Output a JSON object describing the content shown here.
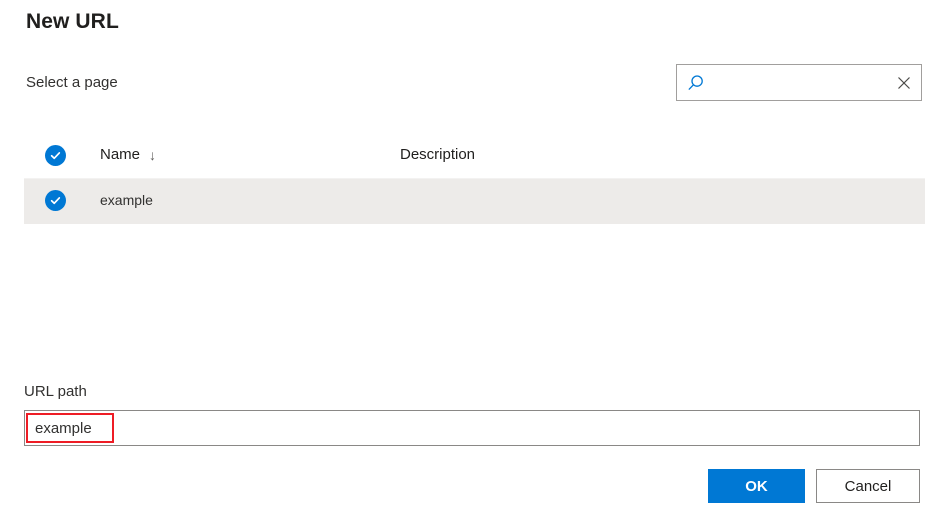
{
  "dialog": {
    "title": "New URL",
    "select_page_label": "Select a page"
  },
  "search": {
    "value": "",
    "placeholder": "",
    "icon": "search-icon",
    "clear_icon": "close-icon"
  },
  "table": {
    "columns": [
      {
        "key": "select",
        "label": ""
      },
      {
        "key": "name",
        "label": "Name",
        "sort": "↓"
      },
      {
        "key": "description",
        "label": "Description"
      }
    ],
    "header_select_all_checked": true,
    "rows": [
      {
        "selected": true,
        "name": "example",
        "description": ""
      }
    ]
  },
  "url_path": {
    "label": "URL path",
    "value": "example",
    "placeholder": ""
  },
  "footer": {
    "ok_label": "OK",
    "cancel_label": "Cancel"
  },
  "colors": {
    "accent": "#0078d4",
    "row_selected_bg": "#edebe9",
    "annotation": "#ee1c25",
    "border": "#8a8886",
    "text": "#201f1e"
  }
}
